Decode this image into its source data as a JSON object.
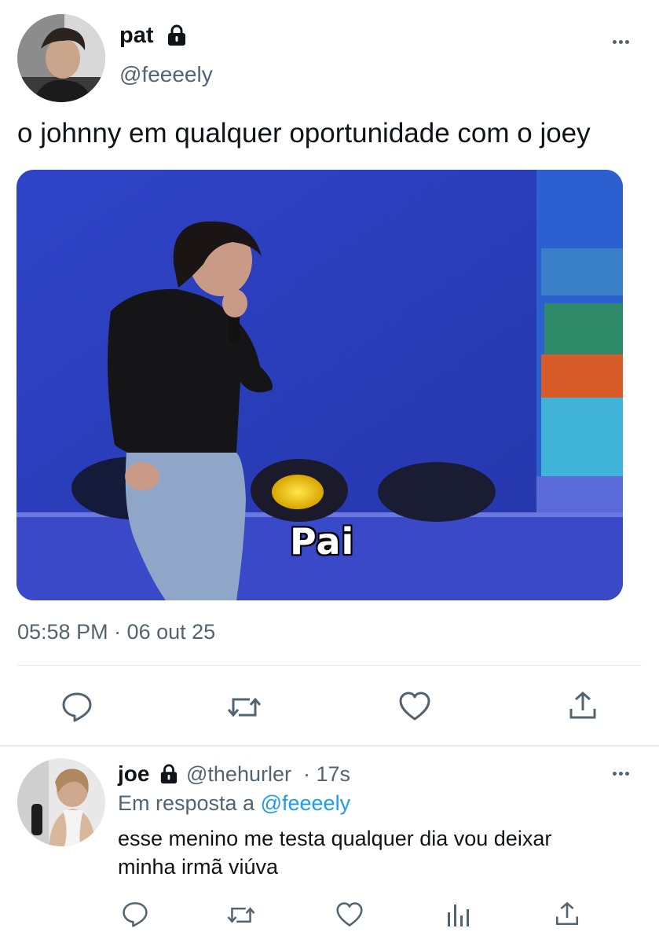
{
  "tweet": {
    "author_name": "pat",
    "author_handle": "@feeeely",
    "text": "o johnny em qualquer oportunidade com o joey",
    "media_caption": "Pai",
    "timestamp": "05:58 PM · 06 out 25",
    "icons": [
      "lock-icon",
      "more-icon",
      "reply-icon",
      "retweet-icon",
      "like-icon",
      "share-icon"
    ]
  },
  "reply": {
    "author_name": "joe",
    "author_handle": "@thehurler",
    "time": "· 17s",
    "in_reply_prefix": "Em resposta a",
    "in_reply_handle": "@feeeely",
    "text_line1": "esse menino me testa qualquer dia vou deixar",
    "text_line2": "minha irmã viúva",
    "icons": [
      "lock-icon",
      "more-icon",
      "reply-icon",
      "retweet-icon",
      "like-icon",
      "analytics-icon",
      "share-icon"
    ]
  },
  "colors": {
    "text": "#0f1419",
    "muted": "#536471",
    "link": "#1d9bf0",
    "divider": "#e6e9ec"
  }
}
